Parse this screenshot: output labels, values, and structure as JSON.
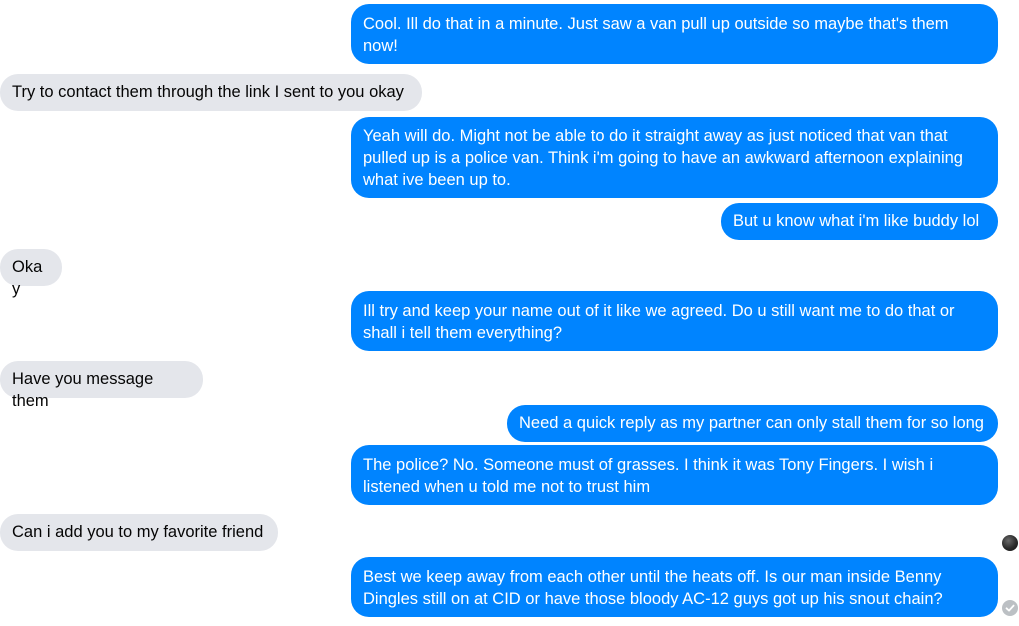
{
  "messages": [
    {
      "sender": "me",
      "text": "Cool. Ill do that in a minute. Just saw a van pull up outside so maybe that's them now!"
    },
    {
      "sender": "them",
      "text": "Try to contact them through the link I sent to you okay"
    },
    {
      "sender": "me",
      "text": "Yeah will do. Might not be able to do it straight away as just noticed that van that pulled up is a police van. Think i'm going to have an awkward afternoon explaining what ive been up to."
    },
    {
      "sender": "me",
      "text": "But u know what i'm like buddy lol"
    },
    {
      "sender": "them",
      "text": "Okay"
    },
    {
      "sender": "me",
      "text": "Ill try and keep your name out of it like we agreed. Do u still want me to do that or shall i tell them everything?"
    },
    {
      "sender": "them",
      "text": "Have you message them"
    },
    {
      "sender": "me",
      "text": "Need a quick reply as my partner can only stall them for so long"
    },
    {
      "sender": "me",
      "text": "The police? No. Someone must of grasses. I think it was Tony Fingers. I wish i listened when u told me not to trust him"
    },
    {
      "sender": "them",
      "text": "Can i add you to my favorite friend"
    },
    {
      "sender": "me",
      "text": "Best we keep away from each other until the heats off. Is our man inside Benny Dingles still on at CID or have those bloody AC-12 guys got up his snout chain?"
    }
  ],
  "icons": {
    "seen_avatar": "contact-avatar-icon",
    "delivered": "check-circle-icon"
  },
  "colors": {
    "outgoing_bubble": "#0084ff",
    "incoming_bubble": "#e4e6eb",
    "outgoing_text": "#ffffff",
    "incoming_text": "#050505"
  }
}
